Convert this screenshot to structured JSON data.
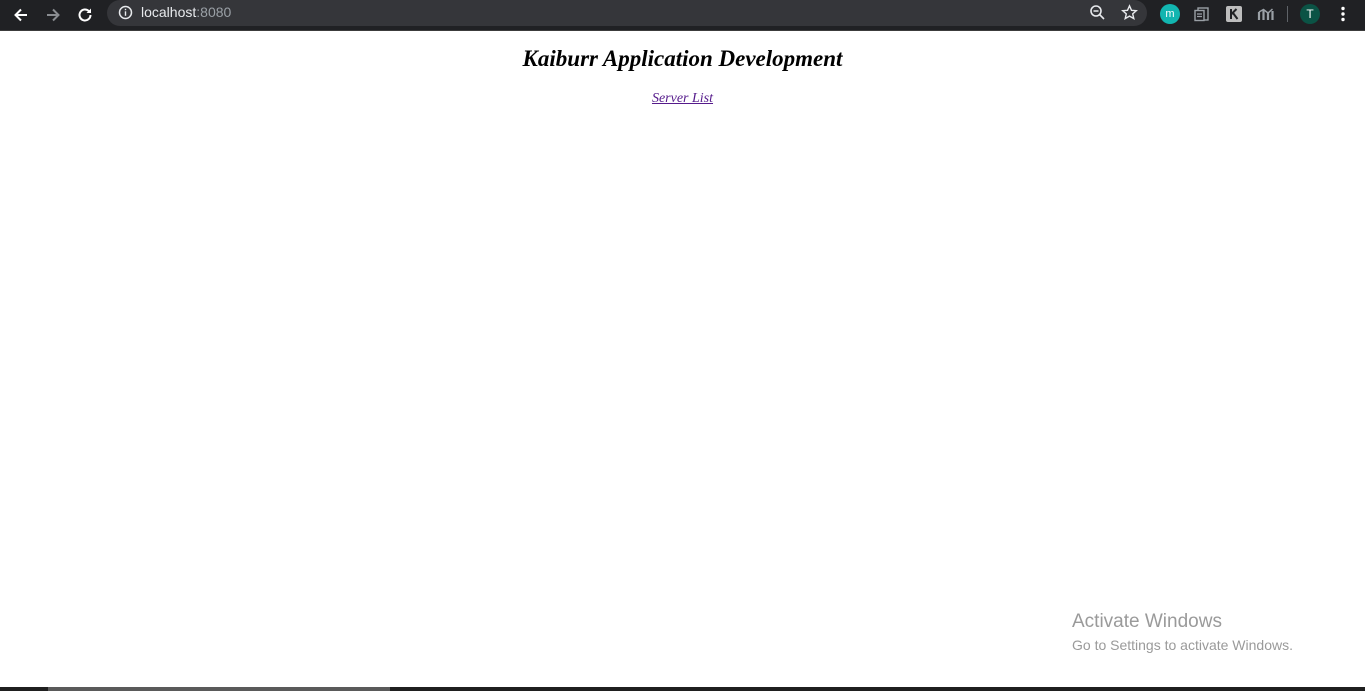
{
  "browser": {
    "url_host": "localhost",
    "url_port": ":8080",
    "profile_initial": "T",
    "extension_initial": "m",
    "icons": [
      "back-arrow-icon",
      "forward-arrow-icon",
      "reload-icon",
      "site-info-icon",
      "zoom-out-icon",
      "star-icon",
      "extension-m-icon",
      "docs-extension-icon",
      "k-extension-icon",
      "chart-extension-icon",
      "menu-kebab-icon"
    ],
    "colors": {
      "toolbar": "#202124",
      "omnibox": "#35363a",
      "profile": "#0b5345",
      "extension_m": "#12b5b0"
    }
  },
  "page": {
    "title": "Kaiburr Application Development",
    "link_label": "Server List",
    "link_color": "#551a8b"
  },
  "watermark": {
    "title": "Activate Windows",
    "subtitle": "Go to Settings to activate Windows."
  }
}
